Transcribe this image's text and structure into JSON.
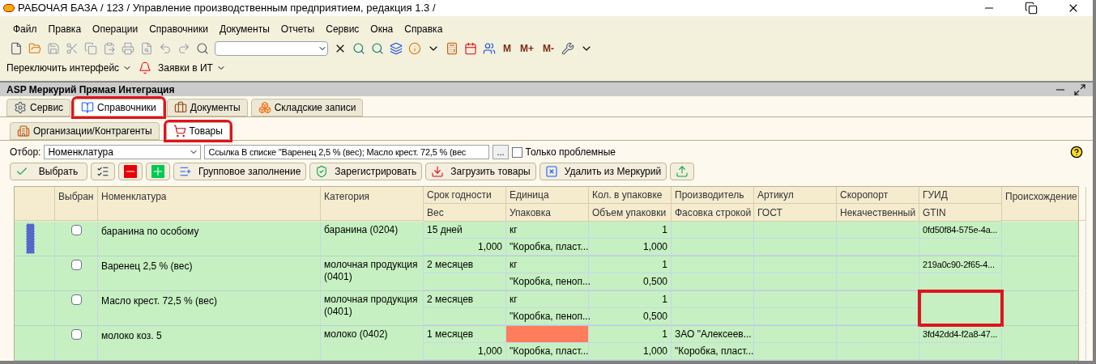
{
  "window": {
    "title": "РАБОЧАЯ БАЗА / 123 /  Управление производственным предприятием, редакция 1.3 /"
  },
  "menu": [
    "Файл",
    "Правка",
    "Операции",
    "Справочники",
    "Документы",
    "Отчеты",
    "Сервис",
    "Окна",
    "Справка"
  ],
  "memory_buttons": [
    "M",
    "M+",
    "M-"
  ],
  "toolbar2": [
    "Переключить интерфейс",
    "Заявки в ИТ"
  ],
  "subwindow": {
    "title": "ASP Меркурий Прямая Интеграция"
  },
  "tabs": [
    {
      "label": "Сервис",
      "selected": false,
      "marked": false
    },
    {
      "label": "Справочники",
      "selected": true,
      "marked": true
    },
    {
      "label": "Документы",
      "selected": false,
      "marked": false
    },
    {
      "label": "Складские записи",
      "selected": false,
      "marked": false
    }
  ],
  "subtabs": [
    {
      "label": "Организации/Контрагенты",
      "selected": false,
      "marked": false
    },
    {
      "label": "Товары",
      "selected": true,
      "marked": true
    }
  ],
  "filter": {
    "label": "Отбор:",
    "field": "Номенклатура",
    "value": "Ссылка В списке \"Варенец 2,5 % (вес); Масло крест. 72,5 % (вес",
    "more": "...",
    "problem_only": {
      "label": "Только проблемные",
      "checked": false
    }
  },
  "actions": [
    {
      "kind": "select",
      "label": "Выбрать"
    },
    {
      "kind": "check-all"
    },
    {
      "kind": "uncheck"
    },
    {
      "kind": "add"
    },
    {
      "kind": "fill",
      "label": "Групповое заполнение"
    },
    {
      "kind": "register",
      "label": "Зарегистрировать"
    },
    {
      "kind": "load",
      "label": "Загрузить товары"
    },
    {
      "kind": "delete",
      "label": "Удалить из Меркурий"
    },
    {
      "kind": "upload"
    }
  ],
  "table": {
    "columns": [
      {},
      {
        "top": "Выбран"
      },
      {
        "top": "Номенклатура"
      },
      {
        "top": "Категория"
      },
      {
        "top": "Срок годности",
        "bottom": "Вес"
      },
      {
        "top": "Единица",
        "bottom": "Упаковка"
      },
      {
        "top": "Кол. в упаковке",
        "bottom": "Объем упаковки"
      },
      {
        "top": "Производитель",
        "bottom": "Фасовка строкой"
      },
      {
        "top": "Артикул",
        "bottom": "ГОСТ"
      },
      {
        "top": "Скоропорт",
        "bottom": "Некачественный"
      },
      {
        "top": "ГУИД",
        "bottom": "GTIN"
      },
      {
        "top": "Происхождение"
      }
    ],
    "rows": [
      {
        "current": true,
        "checked": false,
        "name": "баранина по особому",
        "category": "баранина (0204)",
        "shelf": "15 дней",
        "weight": "1,000",
        "unit": "кг",
        "unit_error": false,
        "pack": "\"Коробка, пласт...",
        "qty": "1",
        "volume": "1,000",
        "producer": "",
        "fasovka": "",
        "guid": "0fd50f84-575e-4a...",
        "guid_marked": false
      },
      {
        "current": false,
        "checked": false,
        "name": "Варенец 2,5 % (вес)",
        "category": "молочная продукция (0401)",
        "shelf": "2 месяцев",
        "weight": "",
        "unit": "кг",
        "unit_error": false,
        "pack": "\"Коробка, пеноп...",
        "qty": "1",
        "volume": "0,500",
        "producer": "",
        "fasovka": "",
        "guid": "219a0c90-2f65-4...",
        "guid_marked": false
      },
      {
        "current": false,
        "checked": false,
        "name": "Масло крест. 72,5 % (вес)",
        "category": "молочная продукция (0401)",
        "shelf": "2 месяцев",
        "weight": "",
        "unit": "кг",
        "unit_error": false,
        "pack": "\"Коробка, пеноп...",
        "qty": "1",
        "volume": "0,500",
        "producer": "",
        "fasovka": "",
        "guid": "",
        "guid_marked": true
      },
      {
        "current": false,
        "checked": false,
        "name": "молоко коз. 5",
        "category": "молоко (0402)",
        "shelf": "1 месяцев",
        "weight": "1,000",
        "unit": "",
        "unit_error": true,
        "pack": "\"Коробка, пласт...",
        "qty": "1",
        "volume": "1,000",
        "producer": "ЗАО \"Алексеев...",
        "fasovka": "\"Коробка, пласт...",
        "guid": "3fd42dd4-f2a8-47...",
        "guid_marked": false
      }
    ]
  }
}
